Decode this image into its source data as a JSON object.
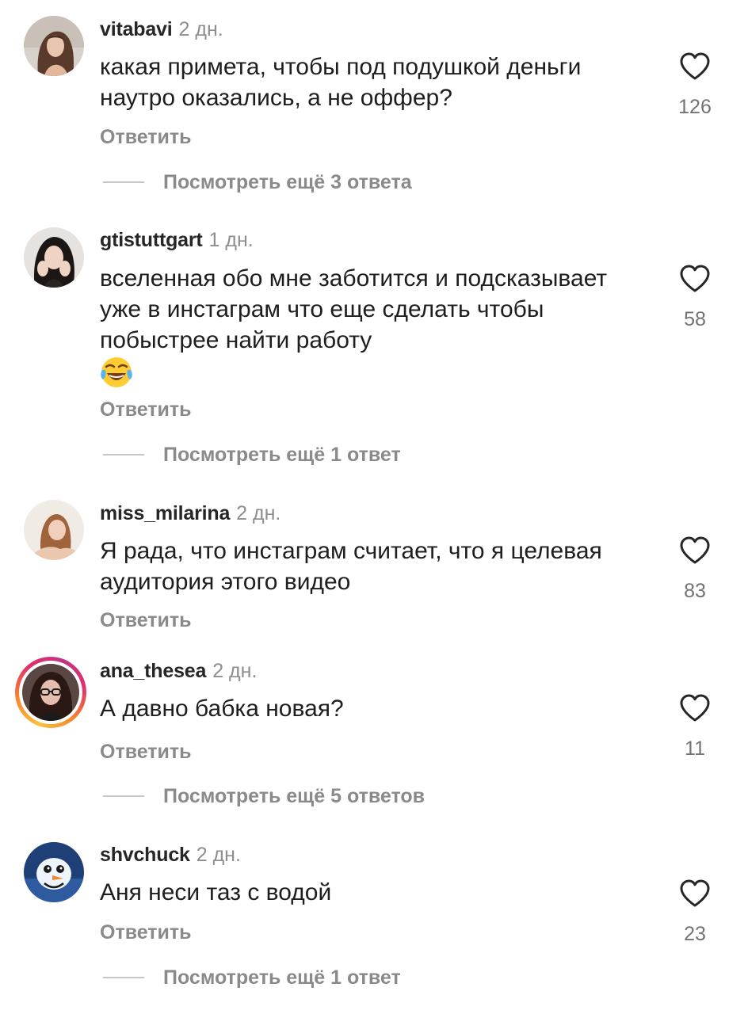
{
  "comments": [
    {
      "username": "vitabavi",
      "time": "2 дн.",
      "text": "какая примета, чтобы под подушкой деньги наутро оказались, а не оффер?",
      "likes": "126",
      "reply_label": "Ответить",
      "more_replies": "Посмотреть ещё 3 ответа",
      "avatar_icon": "user-avatar"
    },
    {
      "username": "gtistuttgart",
      "time": "1 дн.",
      "text": "вселенная обо мне заботится и подсказывает уже в инстаграм что еще сделать чтобы побыстрее найти работу",
      "emoji": "face-with-tears-of-joy",
      "likes": "58",
      "reply_label": "Ответить",
      "more_replies": "Посмотреть ещё 1 ответ",
      "avatar_icon": "user-avatar"
    },
    {
      "username": "miss_milarina",
      "time": "2 дн.",
      "text": "Я рада, что инстаграм считает, что я целевая аудитория этого видео",
      "likes": "83",
      "reply_label": "Ответить",
      "avatar_icon": "user-avatar"
    },
    {
      "username": "ana_thesea",
      "time": "2 дн.",
      "text": "А давно бабка новая?",
      "likes": "11",
      "reply_label": "Ответить",
      "more_replies": "Посмотреть ещё 5 ответов",
      "has_story": true,
      "avatar_icon": "user-avatar"
    },
    {
      "username": "shvchuck",
      "time": "2 дн.",
      "text": "Аня неси таз с водой",
      "likes": "23",
      "reply_label": "Ответить",
      "more_replies": "Посмотреть ещё 1 ответ",
      "avatar_icon": "user-avatar"
    }
  ],
  "icons": {
    "like": "heart-outline-icon"
  },
  "colors": {
    "username": "#262626",
    "secondary": "#8e8e8e",
    "story_ring_start": "#f9c23c",
    "story_ring_end": "#c13584"
  }
}
